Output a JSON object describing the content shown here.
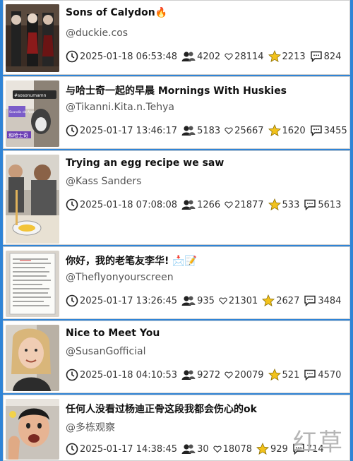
{
  "icons": [
    "clock-icon",
    "users-icon",
    "heart-icon",
    "star-icon",
    "comment-icon"
  ],
  "colors": {
    "background": "#2f84d6",
    "star": "#f2c21b",
    "title": "#111111",
    "author": "#555555"
  },
  "videos": [
    {
      "title": "Sons of Calydon🔥",
      "author": "@duckie.cos",
      "date": "2025-01-18 06:53:48",
      "views": "4202",
      "likes": "28114",
      "favorites": "2213",
      "comments": "824"
    },
    {
      "title": "与哈士奇一起的早晨 Mornings With Huskies",
      "author": "@Tikanni.Kita.n.Tehya",
      "date": "2025-01-17 13:46:17",
      "views": "5183",
      "likes": "25667",
      "favorites": "1620",
      "comments": "3455"
    },
    {
      "title": "Trying an egg recipe we saw",
      "author": "@Kass Sanders",
      "date": "2025-01-18 07:08:08",
      "views": "1266",
      "likes": "21877",
      "favorites": "533",
      "comments": "5613"
    },
    {
      "title": "你好，我的老笔友李华! 📩📝",
      "author": "@Theflyonyourscreen",
      "date": "2025-01-17 13:26:45",
      "views": "935",
      "likes": "21301",
      "favorites": "2627",
      "comments": "3484"
    },
    {
      "title": "Nice to Meet You",
      "author": "@SusanGofficial",
      "date": "2025-01-18 04:10:53",
      "views": "9272",
      "likes": "20079",
      "favorites": "521",
      "comments": "4570"
    },
    {
      "title": "任何人没看过杨迪正骨这段我都会伤心的ok",
      "author": "@多栋观察",
      "date": "2025-01-17 14:38:45",
      "views": "30",
      "likes": "18078",
      "favorites": "929",
      "comments": "714"
    }
  ],
  "thumb_texts": {
    "huskies_banner": "#sosonumamn",
    "huskies_sub": "Scandis de Ajeep",
    "huskies_caption": "和哈士奇"
  },
  "watermark": "红草"
}
